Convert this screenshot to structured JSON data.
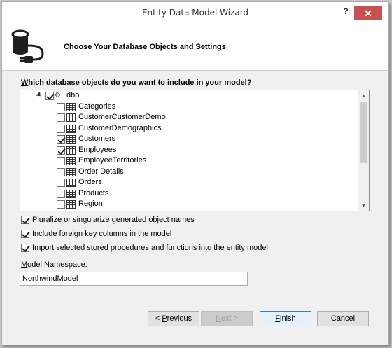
{
  "window": {
    "title": "Entity Data Model Wizard",
    "help_glyph": "?",
    "close_glyph": "✕"
  },
  "header": {
    "title": "Choose Your Database Objects and Settings",
    "icon": "database-plug-icon"
  },
  "question": {
    "prefix": "",
    "accel": "W",
    "rest": "hich database objects do you want to include in your model?"
  },
  "tree": {
    "schema": {
      "label": "dbo",
      "state": "partial",
      "icon": "schema-icon"
    },
    "tables": [
      {
        "label": "Categories",
        "checked": false
      },
      {
        "label": "CustomerCustomerDemo",
        "checked": false
      },
      {
        "label": "CustomerDemographics",
        "checked": false
      },
      {
        "label": "Customers",
        "checked": true
      },
      {
        "label": "Employees",
        "checked": true
      },
      {
        "label": "EmployeeTerritories",
        "checked": false
      },
      {
        "label": "Order Details",
        "checked": false
      },
      {
        "label": "Orders",
        "checked": false
      },
      {
        "label": "Products",
        "checked": false
      },
      {
        "label": "Region",
        "checked": false
      }
    ],
    "scroll_up": "▲",
    "scroll_down": "▼"
  },
  "options": {
    "pluralize": {
      "before": "Pluralize or ",
      "accel": "s",
      "after": "ingularize generated object names",
      "checked": true
    },
    "foreign_keys": {
      "before": "Include foreign ",
      "accel": "k",
      "after": "ey columns in the model",
      "checked": true
    },
    "import_procs": {
      "before": "",
      "accel": "I",
      "after": "mport selected stored procedures and functions into the entity model",
      "checked": true
    }
  },
  "namespace": {
    "label_accel": "M",
    "label_rest": "odel Namespace:",
    "value": "NorthwindModel"
  },
  "buttons": {
    "previous": {
      "accel": "< ",
      "text_accel": "P",
      "rest": "revious"
    },
    "next": {
      "text_accel": "N",
      "rest": "ext >"
    },
    "finish": {
      "text_accel": "F",
      "rest": "inish"
    },
    "cancel": {
      "label": "Cancel"
    }
  },
  "colors": {
    "close_bg": "#c75050",
    "primary_border": "#3c7fb1",
    "body_bg": "#f0f0f0"
  }
}
